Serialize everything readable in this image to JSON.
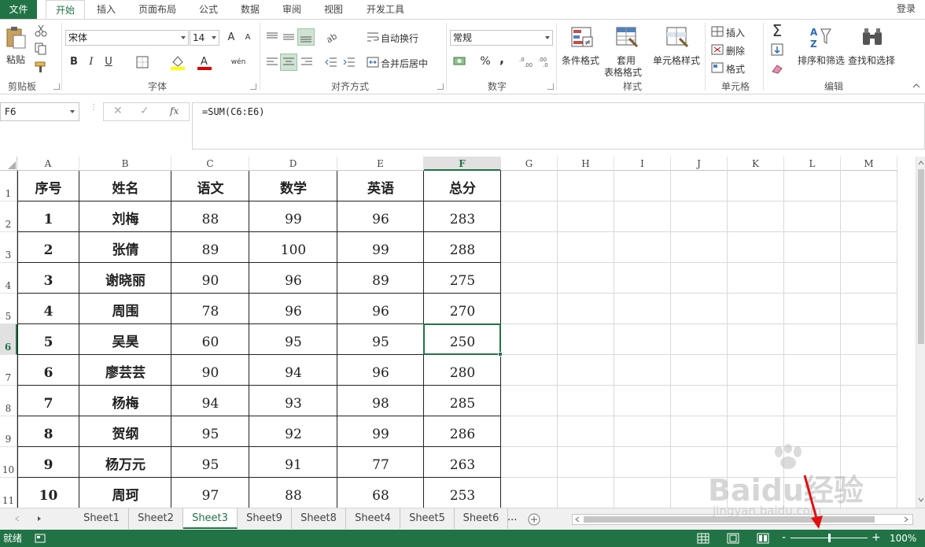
{
  "ribbon_tabs": {
    "file": "文件",
    "home": "开始",
    "insert": "插入",
    "layout": "页面布局",
    "formulas": "公式",
    "data": "数据",
    "review": "审阅",
    "view": "视图",
    "developer": "开发工具",
    "login": "登录"
  },
  "clipboard": {
    "paste": "粘贴",
    "group": "剪贴板"
  },
  "font": {
    "name": "宋体",
    "size": "14",
    "group": "字体",
    "bold": "B",
    "italic": "I",
    "underline": "U",
    "grow": "A",
    "shrink": "A",
    "wen": "wén"
  },
  "alignment": {
    "wrap": "自动换行",
    "merge": "合并后居中",
    "group": "对齐方式"
  },
  "number": {
    "format": "常规",
    "percent": "%",
    "comma": ",",
    "group": "数字"
  },
  "styles": {
    "conditional": "条件格式",
    "table_l1": "套用",
    "table_l2": "表格格式",
    "cell_styles": "单元格样式",
    "group": "样式"
  },
  "cells": {
    "insert": "插入",
    "delete": "删除",
    "format": "格式",
    "group": "单元格"
  },
  "editing": {
    "sort": "排序和筛选",
    "find": "查找和选择",
    "group": "编辑"
  },
  "formula_bar": {
    "name_box": "F6",
    "formula": "=SUM(C6:E6)",
    "fx": "fx"
  },
  "columns": [
    "A",
    "B",
    "C",
    "D",
    "E",
    "F",
    "G",
    "H",
    "I",
    "J",
    "K",
    "L",
    "M"
  ],
  "rows": [
    "1",
    "2",
    "3",
    "4",
    "5",
    "6",
    "7",
    "8",
    "9",
    "10",
    "11"
  ],
  "table": {
    "headers": [
      "序号",
      "姓名",
      "语文",
      "数学",
      "英语",
      "总分"
    ],
    "rows": [
      [
        "1",
        "刘梅",
        "88",
        "99",
        "96",
        "283"
      ],
      [
        "2",
        "张倩",
        "89",
        "100",
        "99",
        "288"
      ],
      [
        "3",
        "谢晓丽",
        "90",
        "96",
        "89",
        "275"
      ],
      [
        "4",
        "周围",
        "78",
        "96",
        "96",
        "270"
      ],
      [
        "5",
        "吴昊",
        "60",
        "95",
        "95",
        "250"
      ],
      [
        "6",
        "廖芸芸",
        "90",
        "94",
        "96",
        "280"
      ],
      [
        "7",
        "杨梅",
        "94",
        "93",
        "98",
        "285"
      ],
      [
        "8",
        "贺纲",
        "95",
        "92",
        "99",
        "286"
      ],
      [
        "9",
        "杨万元",
        "95",
        "91",
        "77",
        "263"
      ],
      [
        "10",
        "周珂",
        "97",
        "88",
        "68",
        "253"
      ]
    ]
  },
  "sheets": [
    "Sheet1",
    "Sheet2",
    "Sheet3",
    "Sheet9",
    "Sheet8",
    "Sheet4",
    "Sheet5",
    "Sheet6"
  ],
  "active_sheet": "Sheet3",
  "more_sheets": "...",
  "status": {
    "ready": "就绪",
    "zoom": "100%",
    "minus": "-",
    "plus": "+"
  },
  "watermark": {
    "brand": "Baidu经验",
    "url": "jingyan.baidu.com"
  },
  "colors": {
    "accent": "#217346",
    "grid": "#d9d9d9"
  }
}
